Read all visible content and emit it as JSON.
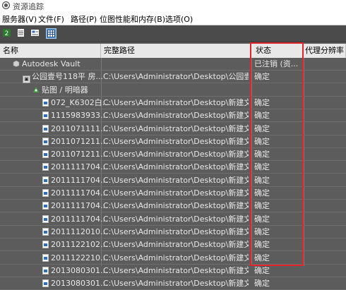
{
  "window": {
    "title": "资源追踪"
  },
  "menu": [
    "服务器(V)",
    "文件(F)",
    "路径(P)",
    "位图性能和内存(B)",
    "选项(O)"
  ],
  "toolbar": [
    {
      "icon": "vault-server-icon"
    },
    {
      "icon": "list-view-icon"
    },
    {
      "icon": "thumbnail-view-icon"
    },
    {
      "icon": "table-view-icon",
      "active": true
    }
  ],
  "columns": {
    "name": "名称",
    "path": "完整路径",
    "status": "状态",
    "proxy": "代理分辨率"
  },
  "rows": [
    {
      "name": "Autodesk Vault",
      "path": "",
      "status": "已注销 (资...",
      "indent": 18,
      "icon": "vault"
    },
    {
      "name": "公园壹号118平  房...",
      "path": "C:\\Users\\Administrator\\Desktop\\公园壹号1...",
      "status": "确定",
      "indent": 32,
      "icon": "max"
    },
    {
      "name": "贴图 / 明暗器",
      "path": "",
      "status": "",
      "indent": 46,
      "icon": "maps"
    },
    {
      "name": "072_K6302白...",
      "path": "C:\\Users\\Administrator\\Desktop\\新建文件...",
      "status": "确定",
      "indent": 60,
      "icon": "file"
    },
    {
      "name": "1115983933...",
      "path": "C:\\Users\\Administrator\\Desktop\\新建文件...",
      "status": "确定",
      "indent": 60,
      "icon": "file"
    },
    {
      "name": "2011071111...",
      "path": "C:\\Users\\Administrator\\Desktop\\新建文件...",
      "status": "确定",
      "indent": 60,
      "icon": "file"
    },
    {
      "name": "2011071211...",
      "path": "C:\\Users\\Administrator\\Desktop\\新建文件...",
      "status": "确定",
      "indent": 60,
      "icon": "file"
    },
    {
      "name": "2011071211...",
      "path": "C:\\Users\\Administrator\\Desktop\\新建文件...",
      "status": "确定",
      "indent": 60,
      "icon": "file"
    },
    {
      "name": "2011111704...",
      "path": "C:\\Users\\Administrator\\Desktop\\新建文件...",
      "status": "确定",
      "indent": 60,
      "icon": "file"
    },
    {
      "name": "2011111704...",
      "path": "C:\\Users\\Administrator\\Desktop\\新建文件...",
      "status": "确定",
      "indent": 60,
      "icon": "file"
    },
    {
      "name": "2011111704...",
      "path": "C:\\Users\\Administrator\\Desktop\\新建文件...",
      "status": "确定",
      "indent": 60,
      "icon": "file"
    },
    {
      "name": "2011111704...",
      "path": "C:\\Users\\Administrator\\Desktop\\新建文件...",
      "status": "确定",
      "indent": 60,
      "icon": "file"
    },
    {
      "name": "2011111704...",
      "path": "C:\\Users\\Administrator\\Desktop\\新建文件...",
      "status": "确定",
      "indent": 60,
      "icon": "file"
    },
    {
      "name": "2011112010...",
      "path": "C:\\Users\\Administrator\\Desktop\\新建文件...",
      "status": "确定",
      "indent": 60,
      "icon": "file"
    },
    {
      "name": "2011122102...",
      "path": "C:\\Users\\Administrator\\Desktop\\新建文件...",
      "status": "确定",
      "indent": 60,
      "icon": "file"
    },
    {
      "name": "2011122210...",
      "path": "C:\\Users\\Administrator\\Desktop\\新建文件...",
      "status": "确定",
      "indent": 60,
      "icon": "file"
    },
    {
      "name": "2013080301...",
      "path": "C:\\Users\\Administrator\\Desktop\\新建文件...",
      "status": "确定",
      "indent": 60,
      "icon": "file"
    },
    {
      "name": "2013080301...",
      "path": "C:\\Users\\Administrator\\Desktop\\新建文件...",
      "status": "确定",
      "indent": 60,
      "icon": "file"
    }
  ]
}
